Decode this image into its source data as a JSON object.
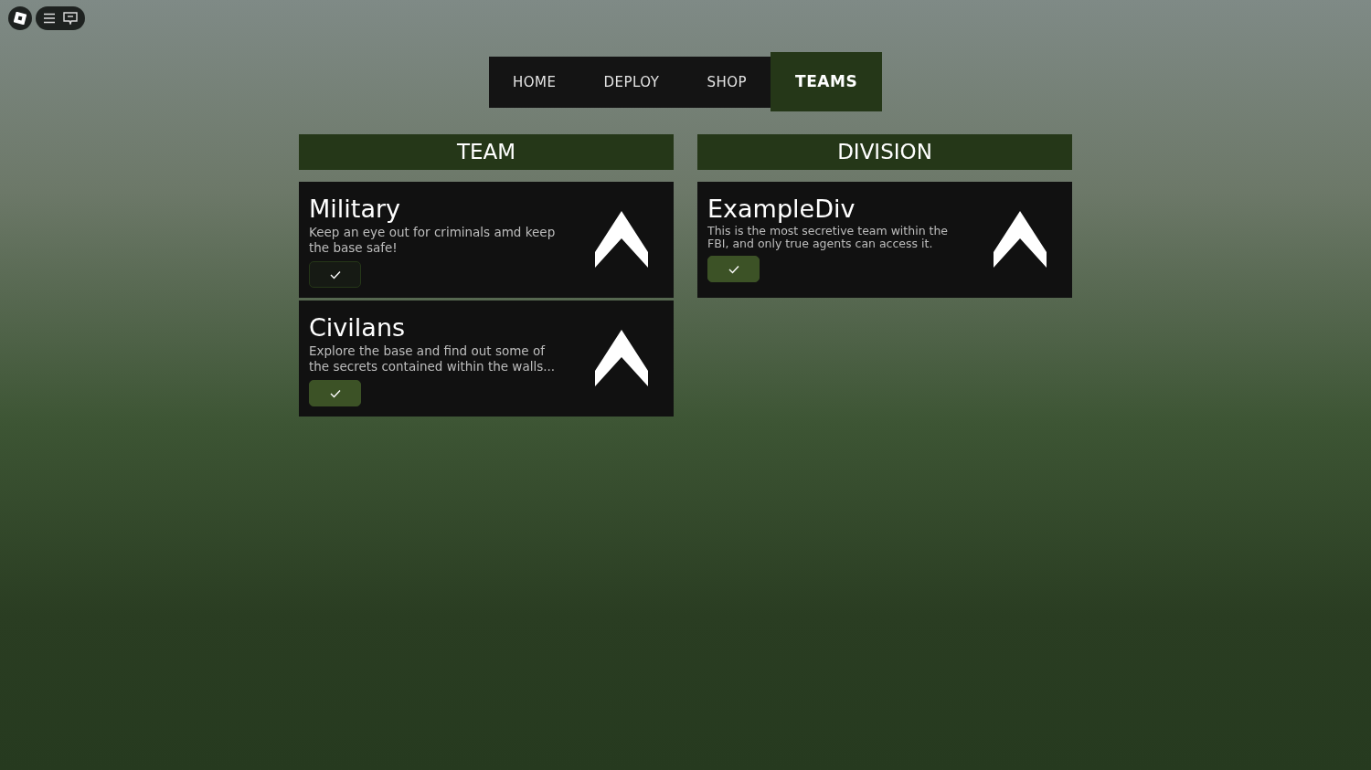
{
  "tabs": [
    {
      "label": "HOME",
      "selected": false
    },
    {
      "label": "DEPLOY",
      "selected": false
    },
    {
      "label": "SHOP",
      "selected": false
    },
    {
      "label": "TEAMS",
      "selected": true
    }
  ],
  "team": {
    "heading": "TEAM",
    "items": [
      {
        "name": "Military",
        "description": "Keep an eye out for criminals amd keep the base safe!",
        "selected": false
      },
      {
        "name": "Civilans",
        "description": "Explore the base and find out some of the secrets contained within the walls...",
        "selected": true
      }
    ]
  },
  "division": {
    "heading": "DIVISION",
    "items": [
      {
        "name": "ExampleDiv",
        "description": "This is the most secretive team within the FBI, and only true agents can access it.",
        "selected": true
      }
    ]
  }
}
